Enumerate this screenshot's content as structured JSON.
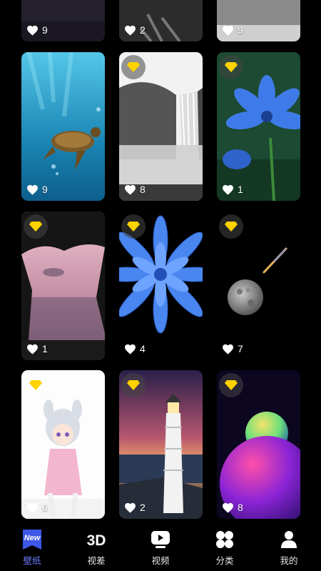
{
  "wallpapers": [
    {
      "subject": "partial-top",
      "likes": "9",
      "vip": false
    },
    {
      "subject": "partial-top",
      "likes": "2",
      "vip": false
    },
    {
      "subject": "partial-top",
      "likes": "9",
      "vip": false
    },
    {
      "subject": "sea turtle underwater",
      "likes": "9",
      "vip": false
    },
    {
      "subject": "black and white waterfall",
      "likes": "8",
      "vip": true
    },
    {
      "subject": "blue flower",
      "likes": "1",
      "vip": true
    },
    {
      "subject": "pink sunset cave",
      "likes": "1",
      "vip": true
    },
    {
      "subject": "blue lotus flower",
      "likes": "4",
      "vip": true
    },
    {
      "subject": "moon and comet",
      "likes": "7",
      "vip": true
    },
    {
      "subject": "anime girl",
      "likes": "6",
      "vip": true
    },
    {
      "subject": "lighthouse at dusk",
      "likes": "2",
      "vip": true
    },
    {
      "subject": "neon planet",
      "likes": "8",
      "vip": true
    }
  ],
  "tabs": [
    {
      "label": "壁纸",
      "icon": "new-icon",
      "active": true
    },
    {
      "label": "视差",
      "icon": "3d-icon",
      "active": false
    },
    {
      "label": "视频",
      "icon": "video-icon",
      "active": false
    },
    {
      "label": "分类",
      "icon": "category-icon",
      "active": false
    },
    {
      "label": "我的",
      "icon": "profile-icon",
      "active": false
    }
  ],
  "colors": {
    "accent": "#6d7cff",
    "vip": "#ffd200",
    "background": "#000000"
  }
}
